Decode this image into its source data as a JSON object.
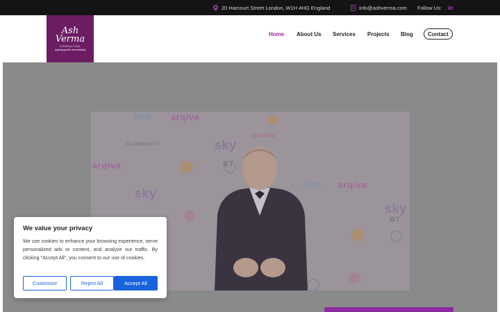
{
  "topbar": {
    "address": "20 Harcourt Street London, W1H 4HG England",
    "email": "info@ashverma.com",
    "follow_label": "Follow Us:",
    "linkedin_label": "in",
    "icons": [
      "location-pin-icon",
      "mail-icon",
      "linkedin-icon"
    ]
  },
  "logo": {
    "line1": "Ash",
    "line2": "Verma",
    "line3": "CONSULTING",
    "tagline": "Inspiring growth and wellbeing",
    "bg_color": "#6b1c63"
  },
  "nav": {
    "items": [
      {
        "label": "Home",
        "active": true
      },
      {
        "label": "About Us"
      },
      {
        "label": "Services"
      },
      {
        "label": "Projects"
      },
      {
        "label": "Blog"
      },
      {
        "label": "Contact"
      }
    ],
    "active_color": "#9b2c9c"
  },
  "backdrop": {
    "logos": [
      "ABS",
      "arqiva",
      "sky",
      "BT",
      "sporting",
      "GLOBECAST",
      "sky",
      "arqiva",
      "ABS",
      "BT",
      "sky",
      "arqiva"
    ]
  },
  "cookie": {
    "title": "We value your privacy",
    "body": "We use cookies to enhance your browsing experience, serve personalized ads or content, and analyze our traffic. By clicking \"Accept All\", you consent to our use of cookies.",
    "customize": "Customize",
    "reject": "Reject All",
    "accept": "Accept All",
    "accent_color": "#1863dc"
  }
}
